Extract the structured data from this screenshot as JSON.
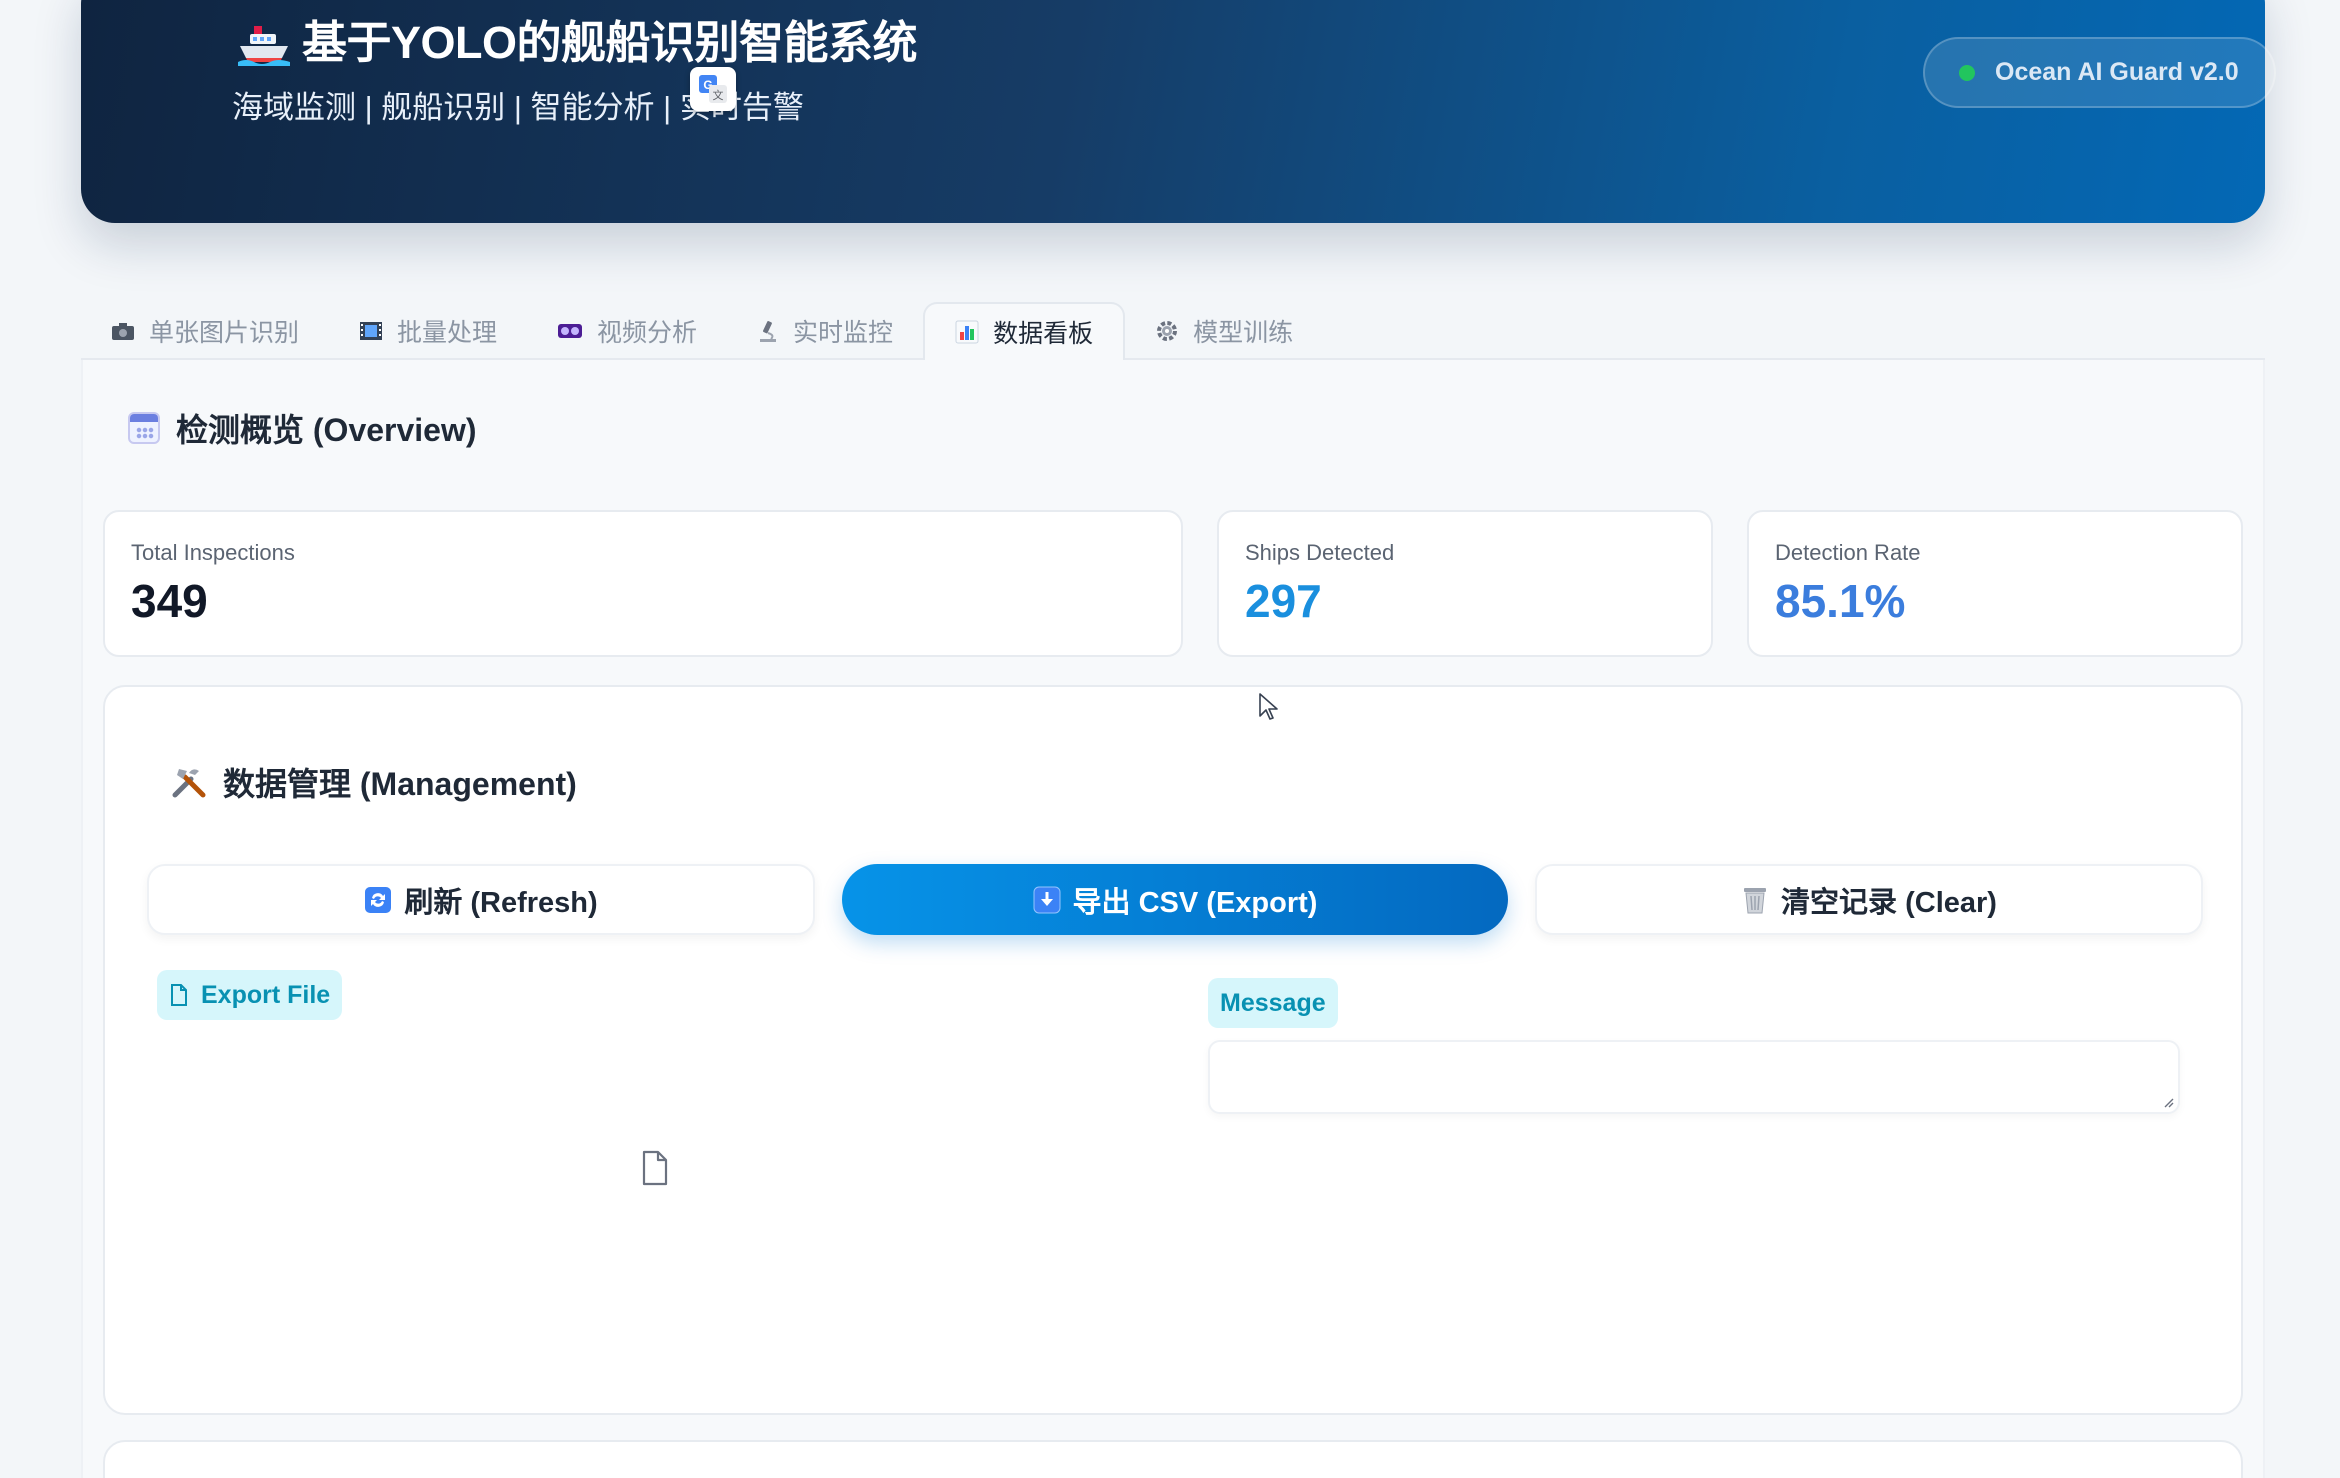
{
  "header": {
    "title": "基于YOLO的舰船识别智能系统",
    "subtitle": "海域监测 | 舰船识别 | 智能分析 | 实时告警",
    "badge": "Ocean AI Guard v2.0",
    "badge_dot_color": "#22c55e"
  },
  "tabs": [
    {
      "icon": "camera-icon",
      "label": "单张图片识别",
      "active": false
    },
    {
      "icon": "film-icon",
      "label": "批量处理",
      "active": false
    },
    {
      "icon": "video-icon",
      "label": "视频分析",
      "active": false
    },
    {
      "icon": "microscope-icon",
      "label": "实时监控",
      "active": false
    },
    {
      "icon": "bar-chart-icon",
      "label": "数据看板",
      "active": true
    },
    {
      "icon": "gear-icon",
      "label": "模型训练",
      "active": false
    }
  ],
  "overview": {
    "title": "检测概览 (Overview)",
    "stats": [
      {
        "label": "Total Inspections",
        "value": "349",
        "color": "#111827"
      },
      {
        "label": "Ships Detected",
        "value": "297",
        "color": "#1a8fde"
      },
      {
        "label": "Detection Rate",
        "value": "85.1%",
        "color": "#3b7ddd"
      }
    ]
  },
  "management": {
    "title": "数据管理 (Management)",
    "refresh_label": "刷新 (Refresh)",
    "export_label": "导出 CSV (Export)",
    "clear_label": "清空记录 (Clear)",
    "export_file_label": "Export File",
    "message_label": "Message",
    "message_value": ""
  },
  "colors": {
    "accent": "#0693e8",
    "header_start": "#0f2440",
    "header_end": "#0368b5"
  }
}
